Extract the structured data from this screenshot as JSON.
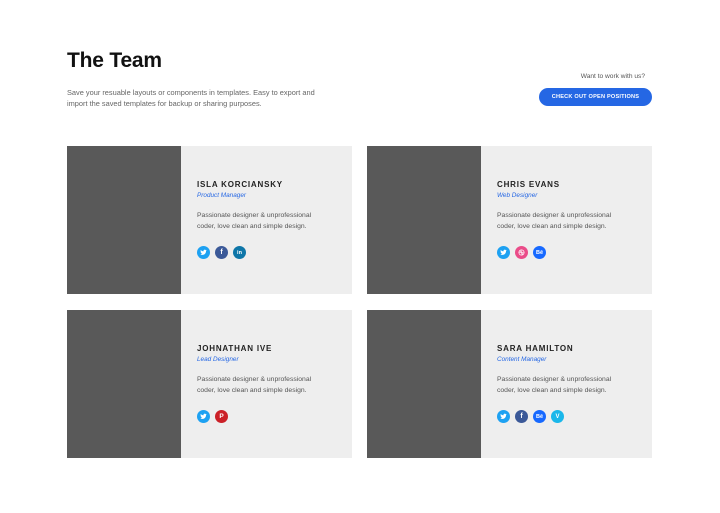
{
  "header": {
    "title": "The Team",
    "subtitle": "Save your resuable layouts or components in templates. Easy to export and import the saved templates for backup or sharing purposes.",
    "cta_prompt": "Want to work with us?",
    "cta_button": "CHECK OUT OPEN POSITIONS"
  },
  "colors": {
    "accent": "#2567e4",
    "photo_placeholder": "#595959",
    "card_background": "#eeeeee",
    "twitter": "#1da1f2",
    "facebook": "#3b5998",
    "linkedin": "#0e76a8",
    "dribbble": "#ea4c89",
    "behance": "#1769ff",
    "pinterest": "#cb2027",
    "vimeo": "#1ab7ea"
  },
  "members": [
    {
      "name": "ISLA KORCIANSKY",
      "role": "Product Manager",
      "bio": "Passionate designer & unprofessional coder, love clean and simple design.",
      "socials": [
        {
          "icon": "twitter-icon",
          "label": ""
        },
        {
          "icon": "facebook-icon",
          "label": "f"
        },
        {
          "icon": "linkedin-icon",
          "label": "in"
        }
      ]
    },
    {
      "name": "CHRIS EVANS",
      "role": "Web Designer",
      "bio": "Passionate designer & unprofessional coder, love clean and simple design.",
      "socials": [
        {
          "icon": "twitter-icon",
          "label": ""
        },
        {
          "icon": "dribbble-icon",
          "label": ""
        },
        {
          "icon": "behance-icon",
          "label": "Bē"
        }
      ]
    },
    {
      "name": "JOHNATHAN IVE",
      "role": "Lead Designer",
      "bio": "Passionate designer & unprofessional coder, love clean and simple design.",
      "socials": [
        {
          "icon": "twitter-icon",
          "label": ""
        },
        {
          "icon": "pinterest-icon",
          "label": "P"
        }
      ]
    },
    {
      "name": "SARA HAMILTON",
      "role": "Content Manager",
      "bio": "Passionate designer & unprofessional coder, love clean and simple design.",
      "socials": [
        {
          "icon": "twitter-icon",
          "label": ""
        },
        {
          "icon": "facebook-icon",
          "label": "f"
        },
        {
          "icon": "behance-icon",
          "label": "Bē"
        },
        {
          "icon": "vimeo-icon",
          "label": "V"
        }
      ]
    }
  ]
}
